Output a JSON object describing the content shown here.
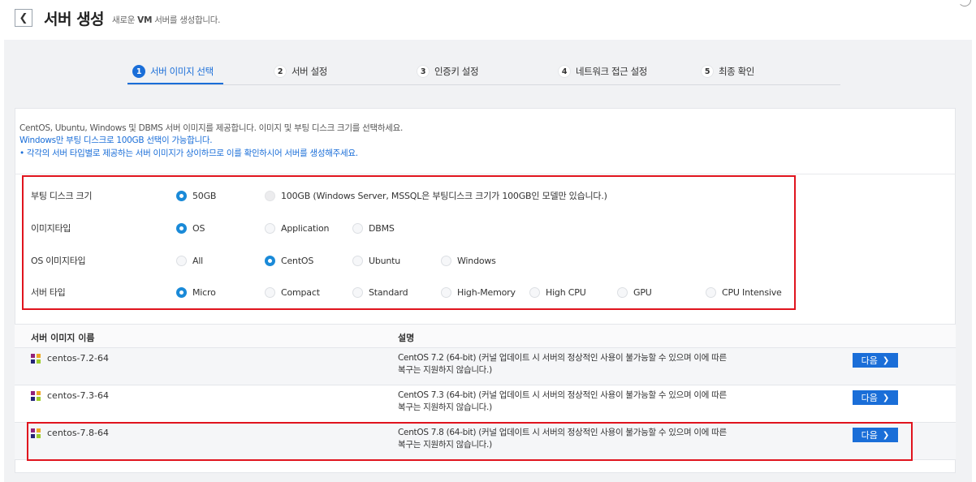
{
  "header": {
    "back_icon": "chevron-left-icon",
    "title": "서버 생성",
    "subtitle_pre": "새로운 ",
    "subtitle_bold": "VM",
    "subtitle_post": " 서버를 생성합니다."
  },
  "steps": [
    {
      "num": "1",
      "label": "서버 이미지 선택",
      "active": true
    },
    {
      "num": "2",
      "label": "서버 설정",
      "active": false
    },
    {
      "num": "3",
      "label": "인증키 설정",
      "active": false
    },
    {
      "num": "4",
      "label": "네트워크 접근 설정",
      "active": false
    },
    {
      "num": "5",
      "label": "최종 확인",
      "active": false
    }
  ],
  "info": {
    "line1": "CentOS, Ubuntu, Windows 및 DBMS 서버 이미지를 제공합니다. 이미지 및 부팅 디스크 크기를 선택하세요.",
    "line2": "Windows만 부팅 디스크로 100GB 선택이 가능합니다.",
    "line3": "• 각각의 서버 타입별로 제공하는 서버 이미지가 상이하므로 이를 확인하시어 서버를 생성해주세요."
  },
  "options": {
    "disk": {
      "label": "부팅 디스크 크기",
      "choices": [
        "50GB",
        "100GB (Windows Server, MSSQL은 부팅디스크 크기가 100GB인 모델만 있습니다.)"
      ],
      "selected": "50GB"
    },
    "image_type": {
      "label": "이미지타입",
      "choices": [
        "OS",
        "Application",
        "DBMS"
      ],
      "selected": "OS"
    },
    "os_type": {
      "label": "OS 이미지타입",
      "choices": [
        "All",
        "CentOS",
        "Ubuntu",
        "Windows"
      ],
      "selected": "CentOS"
    },
    "server_type": {
      "label": "서버 타입",
      "choices": [
        "Micro",
        "Compact",
        "Standard",
        "High-Memory",
        "High CPU",
        "GPU",
        "CPU Intensive"
      ],
      "selected": "Micro"
    }
  },
  "table": {
    "headers": [
      "서버 이미지 이름",
      "설명"
    ],
    "rows": [
      {
        "name": "centos-7.2-64",
        "desc_line1": "CentOS 7.2 (64-bit) (커널 업데이트 시 서버의 정상적인 사용이 불가능할 수 있으며 이에 따른",
        "desc_line2": "복구는 지원하지 않습니다.)",
        "button": "다음"
      },
      {
        "name": "centos-7.3-64",
        "desc_line1": "CentOS 7.3 (64-bit) (커널 업데이트 시 서버의 정상적인 사용이 불가능할 수 있으며 이에 따른",
        "desc_line2": "복구는 지원하지 않습니다.)",
        "button": "다음"
      },
      {
        "name": "centos-7.8-64",
        "desc_line1": "CentOS 7.8 (64-bit) (커널 업데이트 시 서버의 정상적인 사용이 불가능할 수 있으며 이에 따른",
        "desc_line2": "복구는 지원하지 않습니다.)",
        "button": "다음"
      }
    ]
  },
  "colors": {
    "accent": "#1a6ed8",
    "radio_checked": "#1a8ad8",
    "highlight_border": "#e0141e"
  }
}
